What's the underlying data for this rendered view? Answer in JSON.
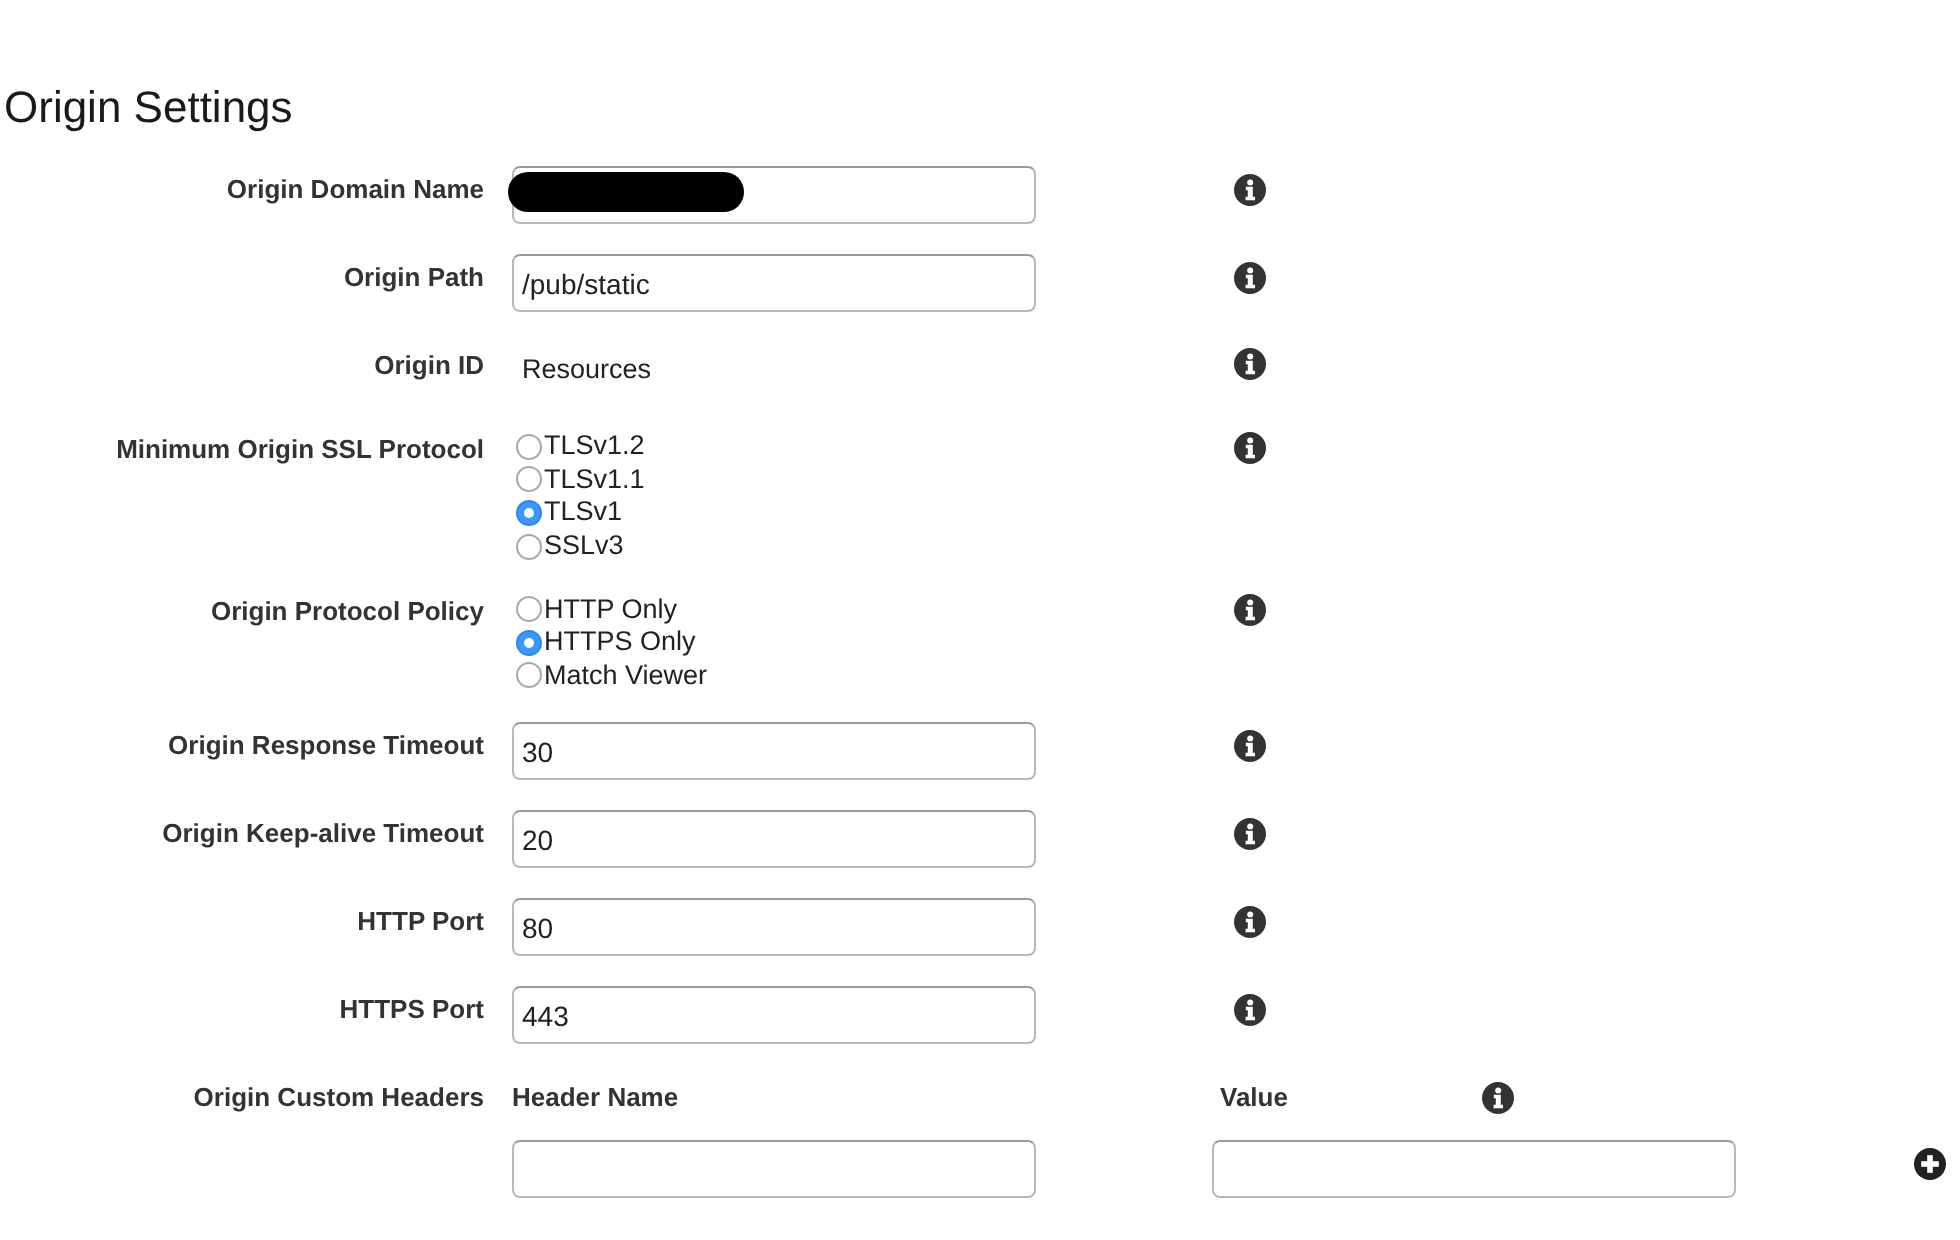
{
  "title": "Origin Settings",
  "fields": [
    {
      "kind": "text",
      "label": "Origin Domain Name",
      "redacted": true
    },
    {
      "kind": "text",
      "label": "Origin Path",
      "value": "/pub/static"
    },
    {
      "kind": "static",
      "label": "Origin ID",
      "value": "Resources"
    },
    {
      "kind": "radio",
      "label": "Minimum Origin SSL Protocol",
      "options": [
        {
          "label": "TLSv1.2",
          "selected": false
        },
        {
          "label": "TLSv1.1",
          "selected": false
        },
        {
          "label": "TLSv1",
          "selected": true
        },
        {
          "label": "SSLv3",
          "selected": false
        }
      ]
    },
    {
      "kind": "radio",
      "label": "Origin Protocol Policy",
      "options": [
        {
          "label": "HTTP Only",
          "selected": false
        },
        {
          "label": "HTTPS Only",
          "selected": true
        },
        {
          "label": "Match Viewer",
          "selected": false
        }
      ]
    },
    {
      "kind": "text",
      "label": "Origin Response Timeout",
      "value": "30"
    },
    {
      "kind": "text",
      "label": "Origin Keep-alive Timeout",
      "value": "20"
    },
    {
      "kind": "text",
      "label": "HTTP Port",
      "value": "80"
    },
    {
      "kind": "text",
      "label": "HTTPS Port",
      "value": "443"
    },
    {
      "kind": "headers",
      "label": "Origin Custom Headers",
      "columns": [
        "Header Name",
        "Value"
      ]
    }
  ]
}
